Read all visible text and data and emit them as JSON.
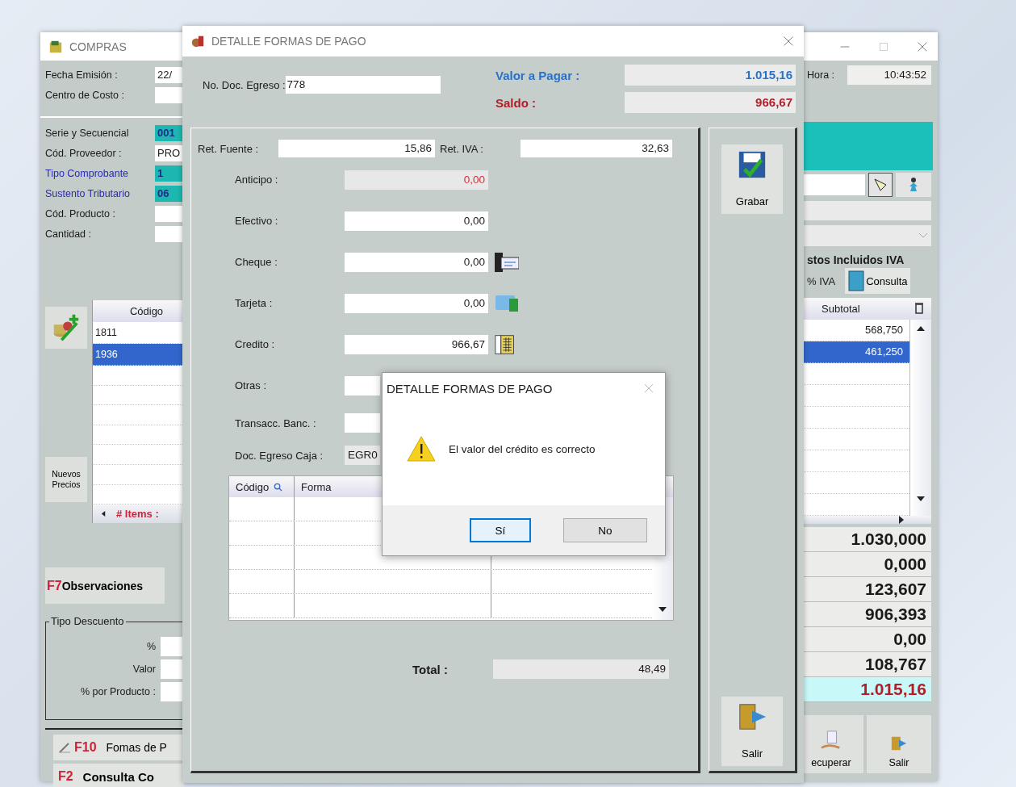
{
  "back_window": {
    "title": "COMPRAS",
    "header_fields": [
      {
        "label": "Fecha Emisión :",
        "value": "22/"
      },
      {
        "label": "Centro de Costo :"
      }
    ],
    "fields": [
      {
        "label": "Serie y Secuencial",
        "value": "001",
        "highlighted": true,
        "color": "#1a1a1a"
      },
      {
        "label": "Cód. Proveedor :",
        "value": "PRO",
        "highlighted": false,
        "color": "#1a1a1a"
      },
      {
        "label": "Tipo Comprobante",
        "value": "1",
        "highlighted": true,
        "color": "#2b2bb0"
      },
      {
        "label": "Sustento Tributario",
        "value": "06",
        "highlighted": true,
        "color": "#2b2bb0"
      },
      {
        "label": "Cód. Producto :",
        "highlighted": false,
        "color": "#1a1a1a"
      },
      {
        "label": "Cantidad :",
        "highlighted": false,
        "color": "#1a1a1a"
      }
    ],
    "hora": {
      "label": "Hora :",
      "value": "10:43:52"
    },
    "grid": {
      "columns": [
        "Código",
        "Subtotal"
      ],
      "rows": [
        {
          "code": "1811",
          "subtotal": "568,750",
          "selected": false
        },
        {
          "code": "1936",
          "subtotal": "461,250",
          "selected": true
        }
      ]
    },
    "nuevos_precios": "Nuevos Precios",
    "items_count": "# Items :",
    "observaciones": {
      "key": "F7",
      "label": "Observaciones"
    },
    "descuento": {
      "title": "Tipo Descuento",
      "rows": [
        "%",
        "Valor",
        "% por Producto :"
      ]
    },
    "bottom_left": [
      {
        "key": "F10",
        "label": "Fomas de P",
        "kind": "edit"
      },
      {
        "key": "F2",
        "label": "Consulta Co",
        "kind": "plain"
      }
    ],
    "caption": "stos Incluidos IVA",
    "iva_label": "% IVA",
    "consulta": "Consulta",
    "totals": [
      {
        "value": "1.030,000",
        "highlighted": false
      },
      {
        "value": "0,000",
        "highlighted": false
      },
      {
        "value": "123,607",
        "highlighted": false
      },
      {
        "value": "906,393",
        "highlighted": false
      },
      {
        "value": "0,00",
        "highlighted": false
      },
      {
        "value": "108,767",
        "highlighted": false
      },
      {
        "value": "1.015,16",
        "highlighted": true
      }
    ],
    "bottom_right": [
      {
        "label": "ecuperar",
        "kind": "recover"
      },
      {
        "label": "Salir",
        "kind": "exit"
      }
    ]
  },
  "dialog": {
    "title": "DETALLE FORMAS DE PAGO",
    "doc_label": "No. Doc. Egreso :",
    "doc_value": "778",
    "valor_label": "Valor a Pagar :",
    "valor": "1.015,16",
    "saldo_label": "Saldo :",
    "saldo": "966,67",
    "retentions": [
      {
        "label": "Ret. Fuente :",
        "value": "15,86"
      },
      {
        "label": "Ret. IVA :",
        "value": "32,63"
      }
    ],
    "payments": [
      {
        "label": "Anticipo :",
        "value": "0,00",
        "readonly": true,
        "kind": "amount"
      },
      {
        "label": "Efectivo :",
        "value": "0,00",
        "readonly": false,
        "kind": "amount"
      },
      {
        "label": "Cheque :",
        "value": "0,00",
        "readonly": false,
        "kind": "cheque"
      },
      {
        "label": "Tarjeta :",
        "value": "0,00",
        "readonly": false,
        "kind": "card"
      },
      {
        "label": "Credito :",
        "value": "966,67",
        "readonly": false,
        "kind": "ledger"
      },
      {
        "label": "Otras :",
        "readonly": false,
        "kind": "covered"
      },
      {
        "label": "Transacc. Banc. :",
        "readonly": false,
        "kind": "compact"
      },
      {
        "label": "Doc. Egreso Caja :",
        "value": "EGR0",
        "readonly": true,
        "kind": "wide"
      }
    ],
    "grid": {
      "columns": [
        "Código",
        "Forma"
      ]
    },
    "total_label": "Total :",
    "total": "48,49",
    "buttons": [
      {
        "label": "Grabar",
        "kind": "save"
      },
      {
        "label": "Salir",
        "kind": "exit"
      }
    ]
  },
  "message_box": {
    "title": "DETALLE FORMAS DE PAGO",
    "message": "El valor del crédito es correcto",
    "buttons": [
      {
        "label": "Sí",
        "selected": true
      },
      {
        "label": "No",
        "selected": false
      }
    ]
  }
}
